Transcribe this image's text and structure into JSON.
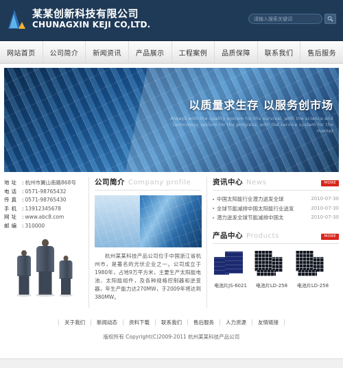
{
  "header": {
    "brand_cn": "某某创新科技有限公司",
    "brand_en": "CHUNAGXIN KEJI CO,LTD.",
    "search_placeholder": "请输入搜索关键词",
    "search_value": ""
  },
  "nav": {
    "items": [
      {
        "label": "网站首页"
      },
      {
        "label": "公司简介"
      },
      {
        "label": "新闻资讯"
      },
      {
        "label": "产品展示"
      },
      {
        "label": "工程案例"
      },
      {
        "label": "品质保障"
      },
      {
        "label": "联系我们"
      },
      {
        "label": "售后服务"
      }
    ]
  },
  "banner": {
    "title": "以质量求生存 以服务创市场",
    "subtitle": "Always with the quality system for the survival, with the science and technology system for the progress, with the service system for the market"
  },
  "contact": {
    "rows": [
      {
        "key": "地址",
        "value": "杭州市翼山南路868号"
      },
      {
        "key": "电话",
        "value": "0571-98765432"
      },
      {
        "key": "传真",
        "value": "0571-98765430"
      },
      {
        "key": "手机",
        "value": "13912345678"
      },
      {
        "key": "网址",
        "value": "www.abc8.com"
      },
      {
        "key": "邮编",
        "value": "310000"
      }
    ]
  },
  "profile": {
    "title_cn": "公司简介",
    "title_en": "Company profile",
    "body": "杭州某某科技产品公司位于中国浙江省杭州市，是著名的光伏企业之一。公司成立于1980年，占地9万平方米，主要生产太阳能电池、太阳能组件，及各种规格控制器和逆变器，年生产能力达270MW，于2009年将达到380MW。"
  },
  "news": {
    "title_cn": "资讯中心",
    "title_en": "News",
    "more_label": "MORE",
    "items": [
      {
        "title": "中国太阳能行业潜力迸发全球",
        "date": "2010-07-30"
      },
      {
        "title": "全球节能减排中国太阳能行业迸发",
        "date": "2010-07-30"
      },
      {
        "title": "潜力迸发全球节能减排中国太",
        "date": "2010-07-30"
      }
    ]
  },
  "products": {
    "title_cn": "产品中心",
    "title_en": "Products",
    "more_label": "MORE",
    "items": [
      {
        "name": "电池片JS-6021",
        "style": "blue"
      },
      {
        "name": "电池片LD-258",
        "style": "dark"
      },
      {
        "name": "电池片LD-258",
        "style": "dark"
      }
    ]
  },
  "footer": {
    "links": [
      {
        "label": "关于我们"
      },
      {
        "label": "新闻动态"
      },
      {
        "label": "资料下载"
      },
      {
        "label": "联系我们"
      },
      {
        "label": "售后服务"
      },
      {
        "label": "人力资源"
      },
      {
        "label": "友情链接"
      }
    ],
    "copyright": "版权所有  Copyright(C)2009-2011 杭州某某科技产品公司"
  },
  "colors": {
    "header_bg": "#1f3a57",
    "accent_blue": "#2e6fb7",
    "accent_yellow": "#f2b431",
    "more_red": "#d9261c"
  }
}
